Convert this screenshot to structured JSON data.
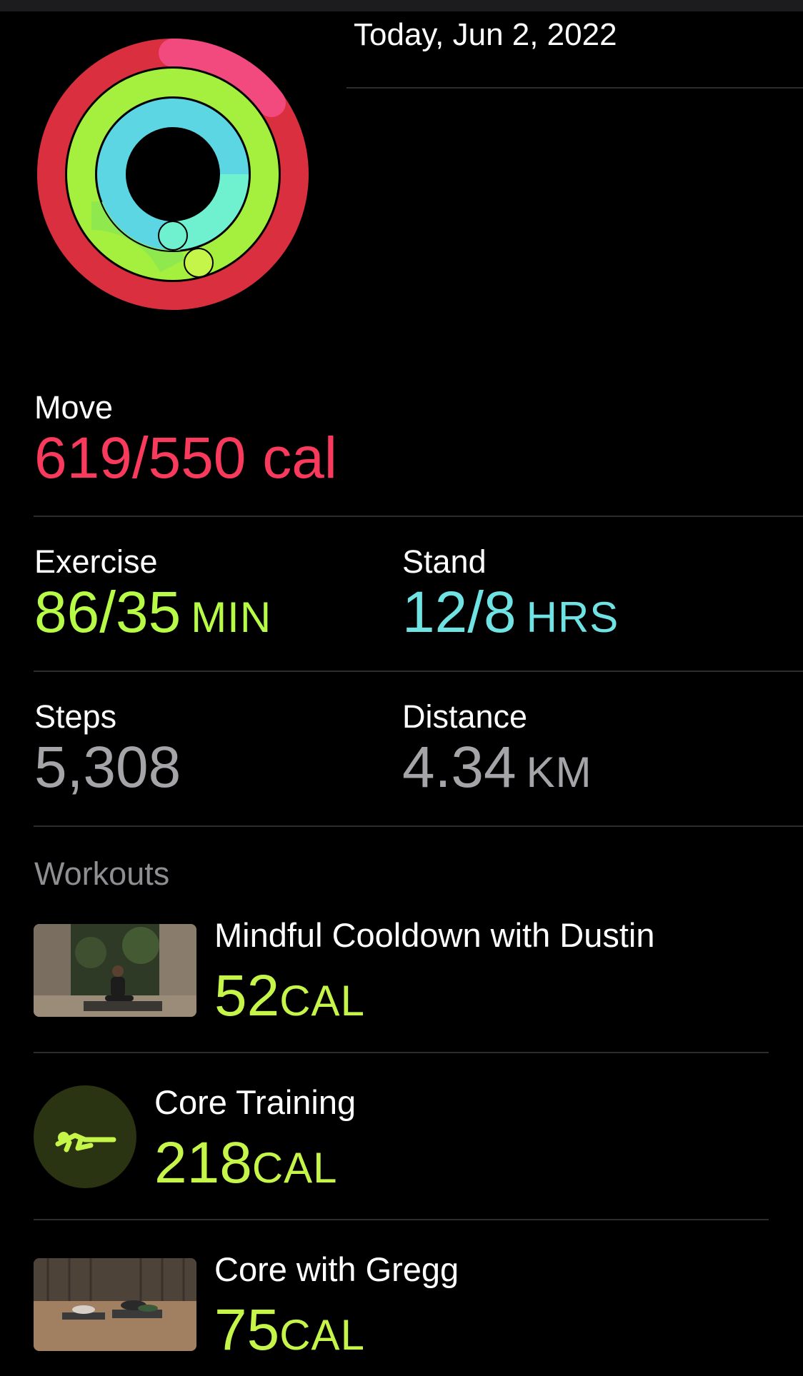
{
  "header": {
    "date": "Today, Jun 2, 2022"
  },
  "rings": {
    "move_progress": 1.125,
    "exercise_progress": 2.457,
    "stand_progress": 1.5,
    "colors": {
      "move": "#fa3a5c",
      "exercise": "#b7fb47",
      "stand": "#5fe5e3"
    }
  },
  "move": {
    "label": "Move",
    "value": "619/550 cal",
    "color": "#fa3a5c"
  },
  "exercise": {
    "label": "Exercise",
    "value": "86/35",
    "unit": "MIN",
    "color": "#b7fb47"
  },
  "stand": {
    "label": "Stand",
    "value": "12/8",
    "unit": "HRS",
    "color": "#6fe3e4"
  },
  "steps": {
    "label": "Steps",
    "value": "5,308"
  },
  "distance": {
    "label": "Distance",
    "value": "4.34",
    "unit": "KM"
  },
  "workouts": {
    "title": "Workouts",
    "items": [
      {
        "name": "Mindful Cooldown with Dustin",
        "value": "52",
        "unit": "CAL",
        "thumb": "video-thumbnail"
      },
      {
        "name": "Core Training",
        "value": "218",
        "unit": "CAL",
        "thumb": "core-training-icon"
      },
      {
        "name": "Core with Gregg",
        "value": "75",
        "unit": "CAL",
        "thumb": "video-thumbnail"
      }
    ]
  }
}
